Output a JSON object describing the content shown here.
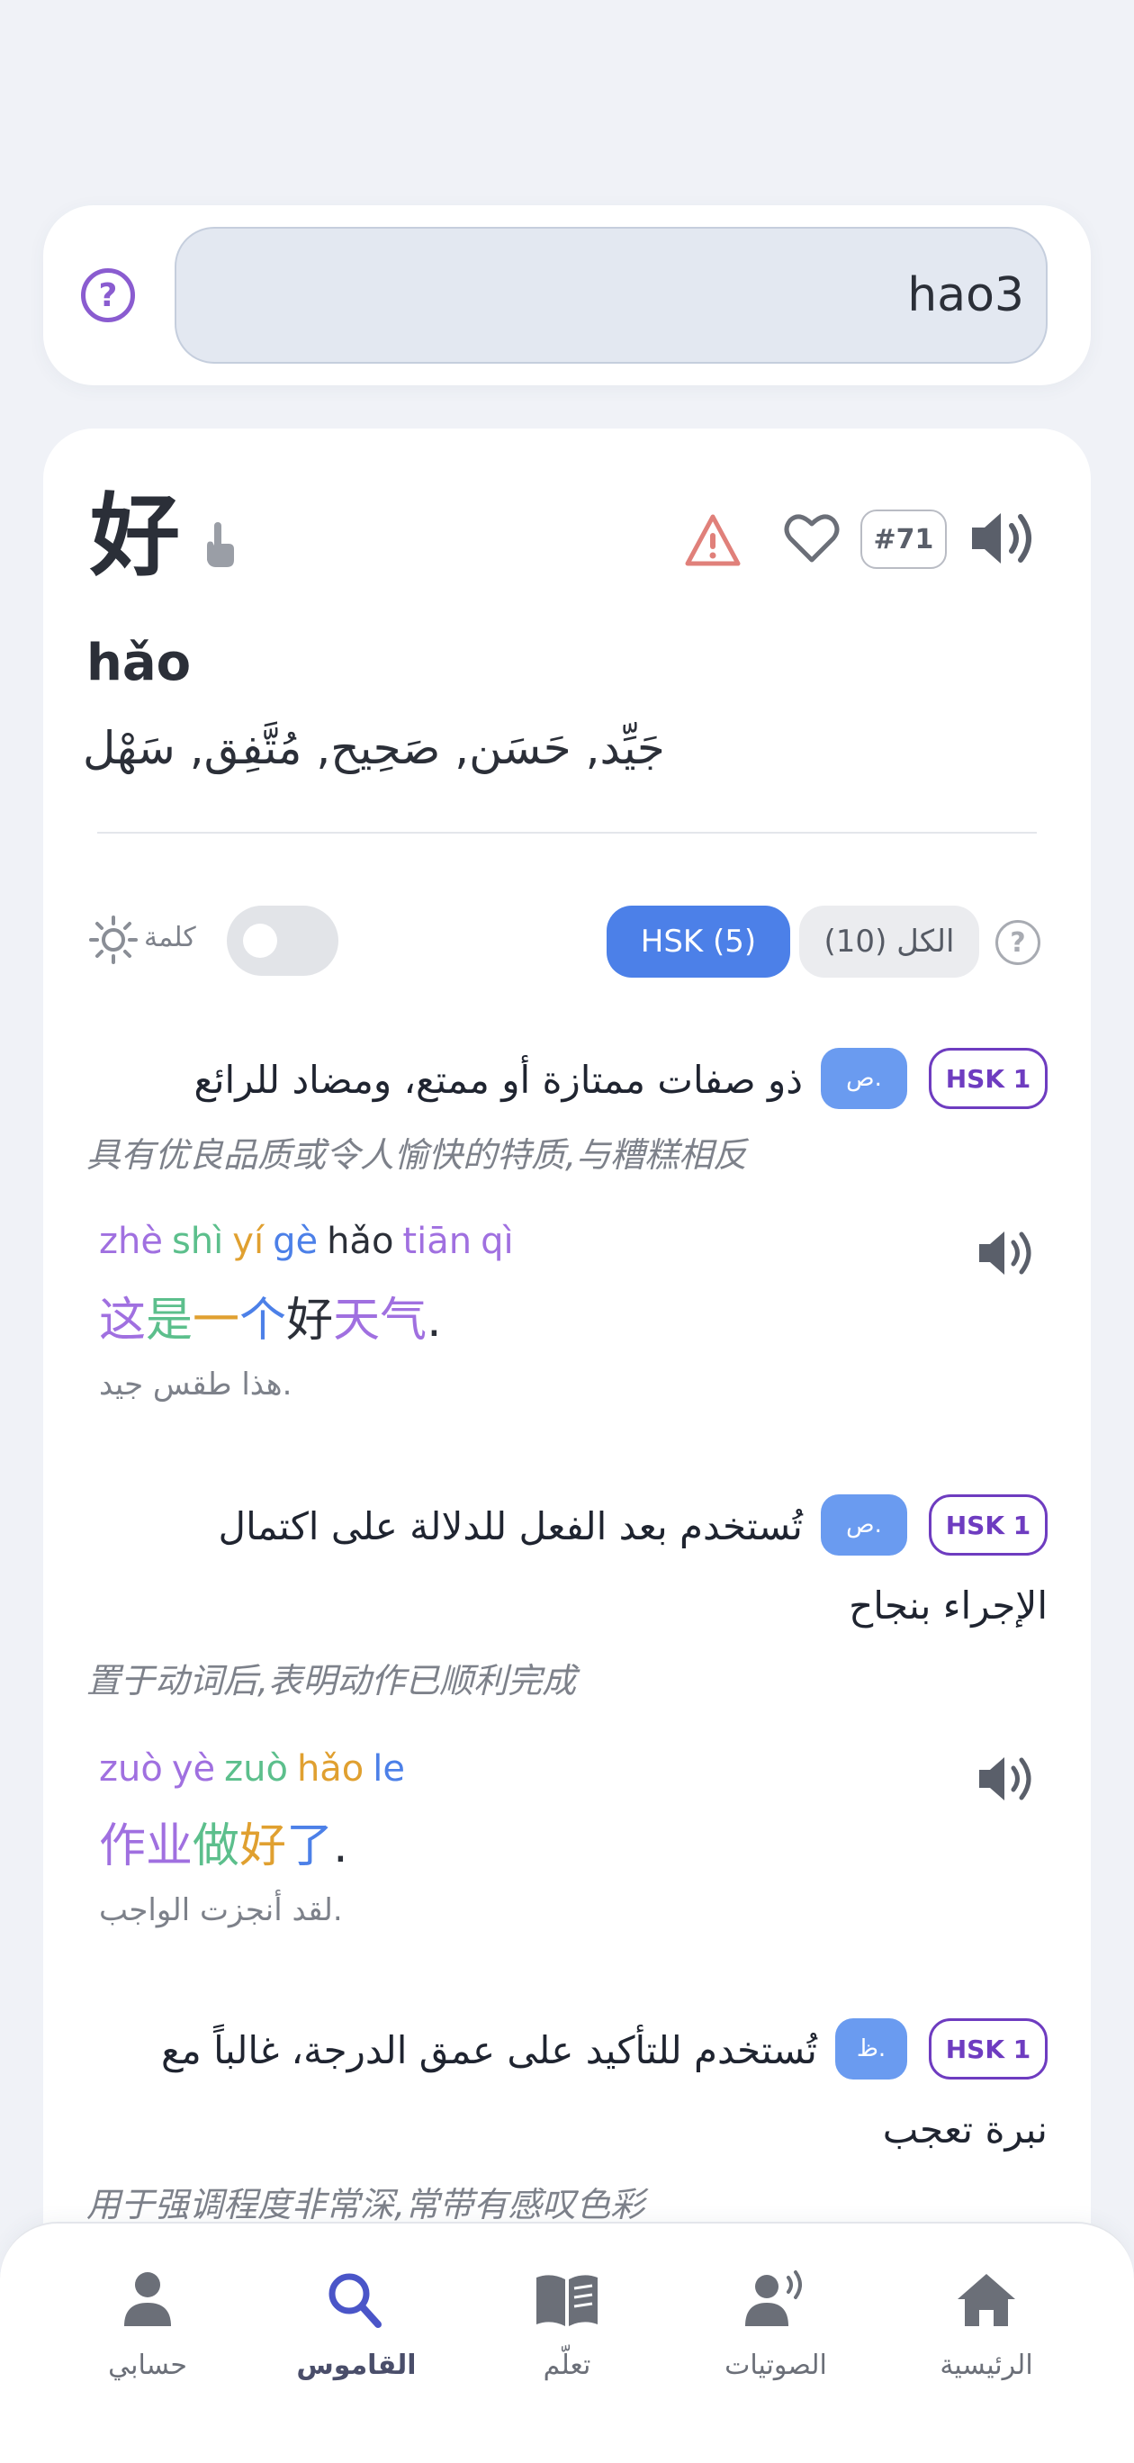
{
  "search": {
    "value": "hao3"
  },
  "entry": {
    "hanzi": "好",
    "rank": "#71",
    "pinyin": "hǎo",
    "arabic": "جَيِّد, حَسَن, صَحِيح, مُتَّفِق, سَهْل"
  },
  "filters": {
    "word_label": "كلمة",
    "hsk_label": "HSK (5)",
    "all_label": "الكل (10)"
  },
  "definitions": [
    {
      "hsk": "HSK 1",
      "pos": "ص.",
      "text_line1": "ذو صفات ممتازة أو ممتع، ومضاد للرائع",
      "text_line2": "",
      "zh": "具有优良品质或令人愉快的特质,与糟糕相反",
      "example": {
        "pinyin": [
          {
            "t": "zhè",
            "c": "purple"
          },
          {
            "t": "shì",
            "c": "green"
          },
          {
            "t": "yí",
            "c": "gold"
          },
          {
            "t": "gè",
            "c": "blue"
          },
          {
            "t": "hǎo",
            "c": "dark"
          },
          {
            "t": "tiān",
            "c": "purple"
          },
          {
            "t": "qì",
            "c": "purple"
          }
        ],
        "hanzi": [
          {
            "t": "这",
            "c": "purple"
          },
          {
            "t": "是",
            "c": "green"
          },
          {
            "t": "一",
            "c": "gold"
          },
          {
            "t": "个",
            "c": "blue"
          },
          {
            "t": "好",
            "c": "dark"
          },
          {
            "t": "天",
            "c": "purple"
          },
          {
            "t": "气",
            "c": "purple"
          },
          {
            "t": ".",
            "c": "dark"
          }
        ],
        "arabic": "هذا طقس جيد."
      }
    },
    {
      "hsk": "HSK 1",
      "pos": "ص.",
      "text_line1": "تُستخدم بعد الفعل للدلالة على اكتمال",
      "text_line2": "الإجراء بنجاح",
      "zh": "置于动词后,表明动作已顺利完成",
      "example": {
        "pinyin": [
          {
            "t": "zuò",
            "c": "purple"
          },
          {
            "t": "yè",
            "c": "purple"
          },
          {
            "t": "zuò",
            "c": "green"
          },
          {
            "t": "hǎo",
            "c": "gold"
          },
          {
            "t": "le",
            "c": "blue"
          }
        ],
        "hanzi": [
          {
            "t": "作",
            "c": "purple"
          },
          {
            "t": "业",
            "c": "purple"
          },
          {
            "t": "做",
            "c": "green"
          },
          {
            "t": "好",
            "c": "gold"
          },
          {
            "t": "了",
            "c": "blue"
          },
          {
            "t": ".",
            "c": "dark"
          }
        ],
        "arabic": "لقد أنجزت الواجب."
      }
    },
    {
      "hsk": "HSK 1",
      "pos": "ظ.",
      "text_line1": "تُستخدم للتأكيد على عمق الدرجة، غالباً مع",
      "text_line2": "نبرة تعجب",
      "zh": "用于强调程度非常深,常带有感叹色彩"
    }
  ],
  "nav": {
    "account": "حسابي",
    "dictionary": "القاموس",
    "learn": "تعلّم",
    "phonetics": "الصوتيات",
    "home": "الرئيسية"
  },
  "colors": {
    "accent": "#4c80e8",
    "hsk_purple": "#6e3cc0",
    "pos_blue": "#6a9bf0"
  }
}
